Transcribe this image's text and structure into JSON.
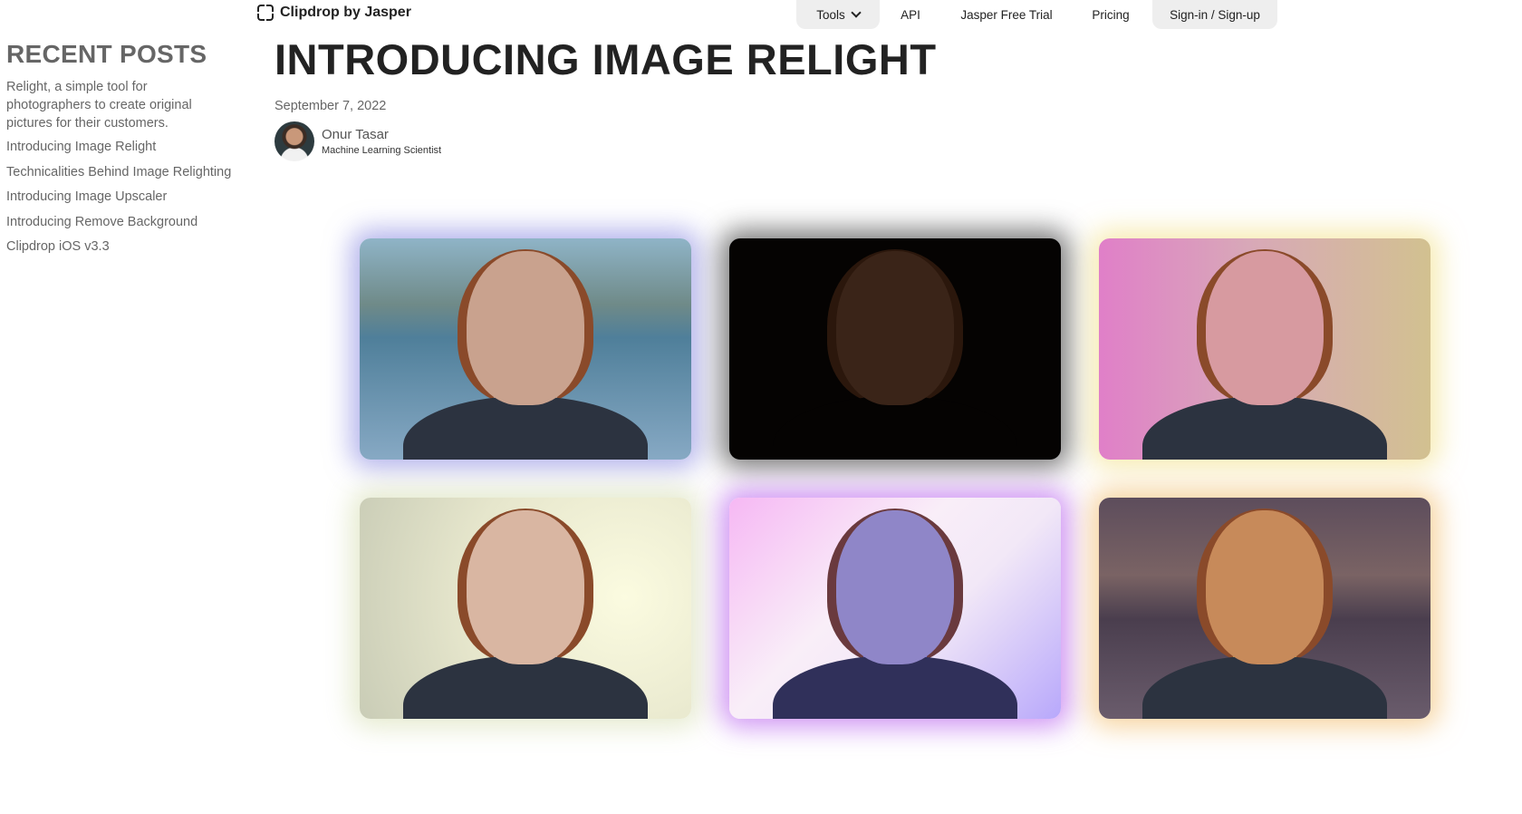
{
  "brand": {
    "name": "Clipdrop by Jasper",
    "icon": "clipdrop-logo-icon"
  },
  "nav": {
    "tools": "Tools",
    "api": "API",
    "trial": "Jasper Free Trial",
    "pricing": "Pricing",
    "signin": "Sign-in / Sign-up"
  },
  "sidebar": {
    "heading": "RECENT POSTS",
    "intro": "Relight, a simple tool for photographers to create original pictures for their customers.",
    "posts": [
      "Introducing Image Relight",
      "Technicalities Behind Image Relighting",
      "Introducing Image Upscaler",
      "Introducing Remove Background",
      "Clipdrop iOS v3.3"
    ]
  },
  "article": {
    "title": "INTRODUCING IMAGE RELIGHT",
    "date": "September 7, 2022",
    "author": {
      "name": "Onur Tasar",
      "role": "Machine Learning Scientist"
    }
  },
  "colors": {
    "glow_1": "#7878dc",
    "glow_2": "#282828",
    "glow_3": "#f0dc78",
    "glow_4": "#c8d296",
    "glow_5": "#be6ef0",
    "glow_6": "#f0b45a"
  }
}
